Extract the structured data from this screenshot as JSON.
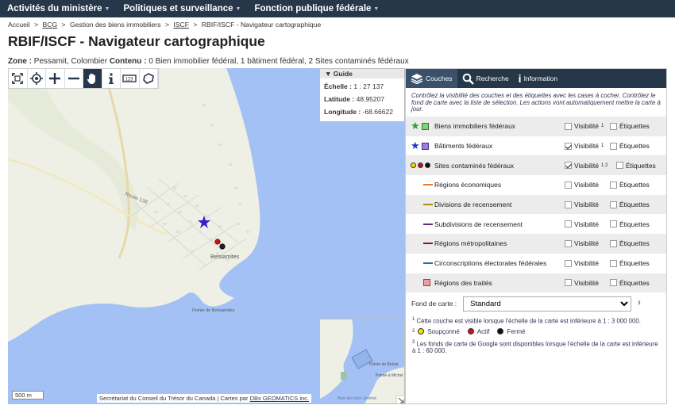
{
  "nav": {
    "items": [
      "Activités du ministère",
      "Politiques et surveillance",
      "Fonction publique fédérale"
    ]
  },
  "breadcrumb": {
    "home": "Accueil",
    "bcg": "BCG",
    "gestion": "Gestion des biens immobiliers",
    "iscf": "ISCF",
    "current": "RBIF/ISCF - Navigateur cartographique",
    "sep": ">"
  },
  "page": {
    "title": "RBIF/ISCF - Navigateur cartographique"
  },
  "zone": {
    "zone_label": "Zone :",
    "zone_value": "Pessamit, Colombier",
    "contenu_label": "Contenu :",
    "contenu_value": "0 Bien immobilier fédéral, 1 bâtiment fédéral, 2 Sites contaminés fédéraux"
  },
  "guide": {
    "header": "Guide",
    "echelle_label": "Échelle :",
    "echelle_value": "1 : 27 137",
    "latitude_label": "Latitude :",
    "latitude_value": "48.95207",
    "longitude_label": "Longitude :",
    "longitude_value": "-68.66622"
  },
  "map": {
    "scale": "500 m",
    "credit_text": "Secrétariat du Conseil du Trésor du Canada | Cartes par",
    "credit_link": "DBx GEOMATICS inc.",
    "road_label": "Route 138",
    "town_label": "Betsiamites",
    "point_label": "Pointe de Betsiamites",
    "mini_label1": "Pointe de Betsia",
    "mini_label2": "Pointe-à Michel",
    "mini_label3": "Baie des Ilets Jérémie"
  },
  "tabs": [
    {
      "label": "Couches"
    },
    {
      "label": "Recherche"
    },
    {
      "label": "Information"
    }
  ],
  "panel": {
    "intro": "Contrôlez la visibilité des couches et des étiquettes avec les cases à cocher. Contrôlez le fond de carte avec la liste de sélection. Les actions vont automatiquement mettre la carte à jour.",
    "visibilite": "Visibilité",
    "etiquettes": "Étiquettes",
    "layers": [
      {
        "name": "Biens immobiliers fédéraux",
        "visible": false,
        "sup": "1",
        "color": "#2ca02c"
      },
      {
        "name": "Bâtiments fédéraux",
        "visible": true,
        "sup": "1",
        "color": "#2233cc"
      },
      {
        "name": "Sites contaminés fédéraux",
        "visible": true,
        "sup": "1 2",
        "color": "#cc0000"
      },
      {
        "name": "Régions économiques",
        "visible": false,
        "sup": "",
        "color": "#e87a2d"
      },
      {
        "name": "Divisions de recensement",
        "visible": false,
        "sup": "",
        "color": "#b8860b"
      },
      {
        "name": "Subdivisions de recensement",
        "visible": false,
        "sup": "",
        "color": "#5a2a82"
      },
      {
        "name": "Régions métropolitaines",
        "visible": false,
        "sup": "",
        "color": "#a01010"
      },
      {
        "name": "Circonscriptions électorales fédérales",
        "visible": false,
        "sup": "",
        "color": "#2a6ab0"
      },
      {
        "name": "Régions des traités",
        "visible": false,
        "sup": "",
        "color": "#e8a0a0"
      }
    ],
    "fond_label": "Fond de carte :",
    "fond_value": "Standard",
    "fond_sup": "3",
    "note1_num": "1",
    "note1": "Cette couche est visible lorsque l'échelle de la carte est inférieure à 1 : 3 000 000.",
    "note2_num": "2",
    "soupconne": "Soupçonné",
    "actif": "Actif",
    "ferme": "Fermé",
    "note3_num": "3",
    "note3": "Les fonds de carte de Google sont disponibles lorsque l'échelle de la carte est inférieure à 1 : 60 000."
  },
  "colors": {
    "nav": "#26374a",
    "water": "#a3c1f5",
    "land": "#eef0e6",
    "accent": "#2233cc"
  }
}
